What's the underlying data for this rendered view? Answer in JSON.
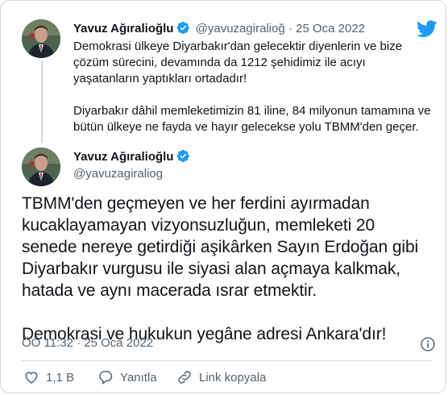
{
  "parent_tweet": {
    "name": "Yavuz Ağıralioğlu",
    "handle": "@yavuzagiralioğ",
    "separator": "·",
    "date": "25 Oca 2022",
    "paragraphs": [
      "Demokrasi ülkeye Diyarbakır'dan gelecektir diyenlerin ve bize çözüm sürecini, devamında da 1212 şehidimiz ile acıyı yaşatanların yaptıkları ortadadır!",
      "Diyarbakır dâhil memleketimizin 81 iline, 84 milyonun tamamına ve bütün ülkeye ne fayda ve hayır gelecekse yolu TBMM'den geçer."
    ]
  },
  "main_tweet": {
    "name": "Yavuz Ağıralioğlu",
    "handle": "@yavuzagiraliog",
    "paragraphs": [
      "TBMM'den geçmeyen ve her ferdini ayırmadan kucaklayamayan vizyonsuzluğun, memleketi 20 senede nereye getirdiği aşikârken Sayın Erdoğan gibi Diyarbakır vurgusu ile siyasi alan açmaya kalkmak, hatada ve aynı macerada ısrar etmektir.",
      "Demokrasi ve hukukun yegâne adresi Ankara'dır!"
    ],
    "timestamp": "ÖÖ 11:32 · 25 Oca 2022"
  },
  "actions": {
    "like_count": "1,1 B",
    "reply_label": "Yanıtla",
    "copy_link_label": "Link kopyala"
  },
  "icons": {
    "brand": "twitter-bird-icon",
    "verified": "verified-badge-icon",
    "info": "info-icon",
    "like": "heart-icon",
    "reply": "reply-bubble-icon",
    "link": "link-icon"
  },
  "colors": {
    "brand_blue": "#1d9bf0",
    "text_primary": "#0f1419",
    "text_secondary": "#536471",
    "border": "#cfd9de"
  }
}
